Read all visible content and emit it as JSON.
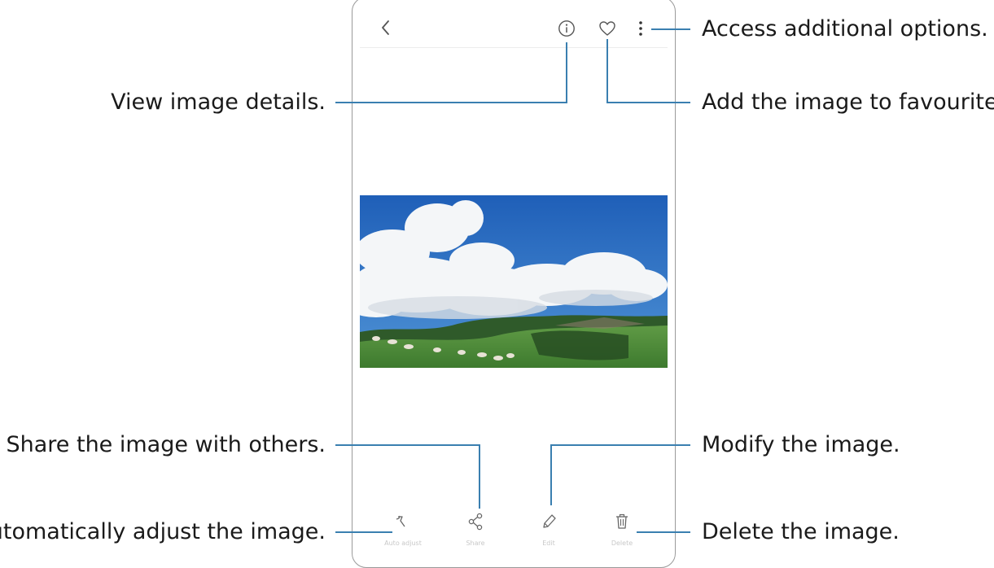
{
  "viewer": {
    "back_icon": "chevron-left-icon",
    "info_icon": "info-icon",
    "favourite_icon": "heart-icon",
    "more_icon": "more-vertical-icon"
  },
  "bottom_bar": {
    "items": [
      {
        "label": "Auto adjust",
        "icon": "magic-wand-icon"
      },
      {
        "label": "Share",
        "icon": "share-icon"
      },
      {
        "label": "Edit",
        "icon": "pencil-icon"
      },
      {
        "label": "Delete",
        "icon": "trash-icon"
      }
    ]
  },
  "callouts": {
    "more_options": "Access additional options.",
    "details": "View image details.",
    "favourites": "Add the image to favourites.",
    "share": "Share the image with others.",
    "edit": "Modify the image.",
    "auto_adjust": "Automatically adjust the image.",
    "delete": "Delete the image."
  },
  "colors": {
    "callout_line": "#3a7fb0",
    "icon": "#555555",
    "sky": "#2f74c6",
    "grass": "#4b8a3a"
  }
}
